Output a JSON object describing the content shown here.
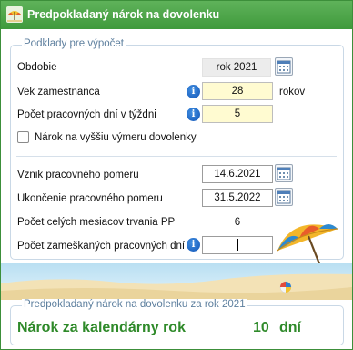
{
  "window": {
    "title": "Predpokladaný nárok na dovolenku"
  },
  "inputs_group": {
    "legend": "Podklady pre výpočet",
    "period": {
      "label": "Obdobie",
      "value": "rok 2021"
    },
    "age": {
      "label": "Vek zamestnanca",
      "value": "28",
      "unit": "rokov"
    },
    "workdays": {
      "label": "Počet pracovných dní v týždni",
      "value": "5"
    },
    "higher_entitlement": {
      "label": "Nárok na vyššiu výmeru dovolenky",
      "checked": false
    },
    "start": {
      "label": "Vznik pracovného pomeru",
      "value": "14.6.2021"
    },
    "end": {
      "label": "Ukončenie pracovného pomeru",
      "value": "31.5.2022"
    },
    "months": {
      "label": "Počet celých mesiacov trvania PP",
      "value": "6"
    },
    "missed": {
      "label": "Počet zameškaných pracovných dní",
      "value": ""
    }
  },
  "result_group": {
    "legend": "Predpokladaný nárok na dovolenku za rok 2021",
    "label": "Nárok za kalendárny rok",
    "value": "10",
    "unit": "dní"
  },
  "icons": {
    "app": "umbrella-icon",
    "calendar": "calendar-icon",
    "info": "info-icon"
  },
  "colors": {
    "titlebar": "#4aa546",
    "accent_green": "#2f8a2a",
    "legend_blue": "#5d7f9e",
    "highlight_yellow": "#fffbd1"
  }
}
